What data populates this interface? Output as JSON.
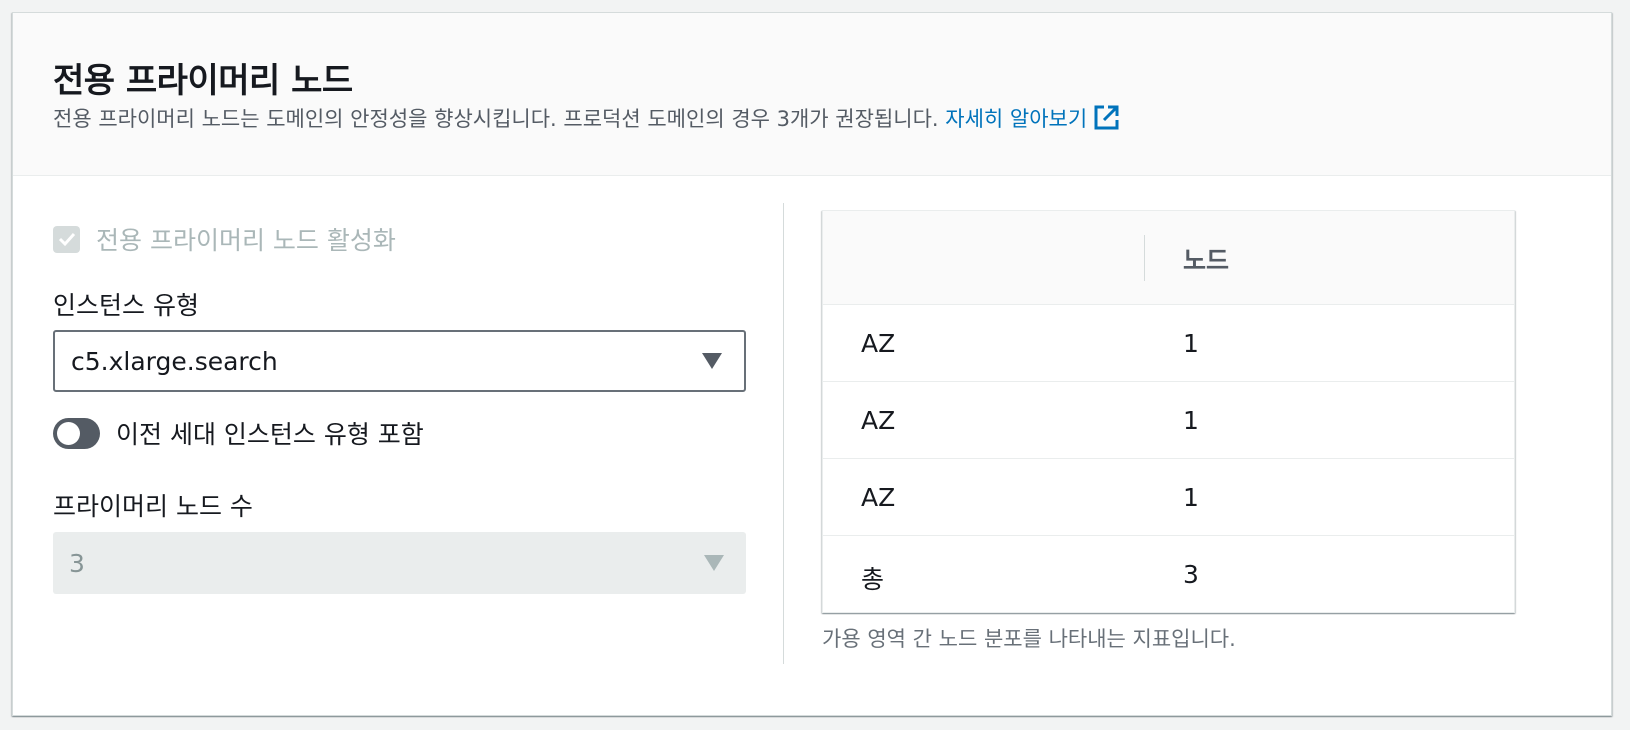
{
  "header": {
    "title": "전용 프라이머리 노드",
    "description": "전용 프라이머리 노드는 도메인의 안정성을 향상시킵니다. 프로덕션 도메인의 경우 3개가 권장됩니다.",
    "learn_more": "자세히 알아보기"
  },
  "form": {
    "enable_checkbox_label": "전용 프라이머리 노드 활성화",
    "enable_checked": true,
    "instance_type_label": "인스턴스 유형",
    "instance_type_value": "c5.xlarge.search",
    "prev_gen_toggle_label": "이전 세대 인스턴스 유형 포함",
    "prev_gen_enabled": false,
    "node_count_label": "프라이머리 노드 수",
    "node_count_value": "3"
  },
  "table": {
    "col1_header": "",
    "col2_header": "노드",
    "rows": [
      {
        "az": "AZ",
        "nodes": "1"
      },
      {
        "az": "AZ",
        "nodes": "1"
      },
      {
        "az": "AZ",
        "nodes": "1"
      },
      {
        "az": "총",
        "nodes": "3"
      }
    ],
    "caption": "가용 영역 간 노드 분포를 나타내는 지표입니다."
  },
  "colors": {
    "link": "#0073bb",
    "toggle_off": "#545b64",
    "disabled_text": "#aab7b8"
  }
}
